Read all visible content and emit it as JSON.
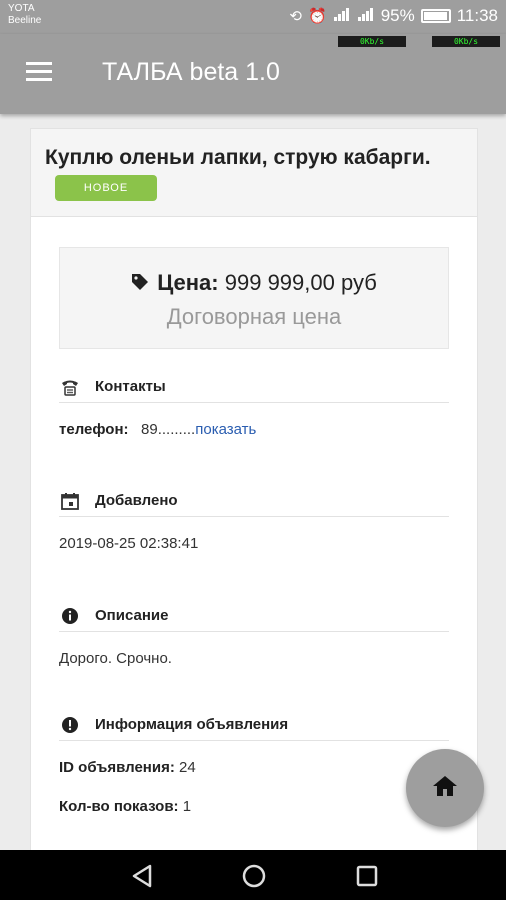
{
  "status_bar": {
    "carrier_line1": "YOTA",
    "carrier_line2": "Beeline",
    "battery": "95%",
    "time": "11:38",
    "net_speed_1": "0Kb/s",
    "net_speed_2": "0Kb/s"
  },
  "app_bar": {
    "title": "ТАЛБА beta 1.0"
  },
  "ad": {
    "title": "Куплю оленьи лапки, струю кабарги.",
    "badge": "НОВОЕ",
    "price_label": "Цена:",
    "price_value": "999 999,00 руб",
    "price_note": "Договорная цена"
  },
  "contacts": {
    "heading": "Контакты",
    "phone_label": "телефон:",
    "phone_value": "89.........",
    "show_link": "показать"
  },
  "added": {
    "heading": "Добавлено",
    "value": "2019-08-25 02:38:41"
  },
  "description": {
    "heading": "Описание",
    "text": "Дорого. Срочно."
  },
  "info": {
    "heading": "Информация объявления",
    "id_label": "ID объявления:",
    "id_value": "24",
    "views_label": "Кол-во показов:",
    "views_value": "1"
  },
  "colors": {
    "app_bar": "#9e9e9e",
    "badge": "#8bc34a",
    "link": "#2a5db0"
  },
  "icons": [
    "menu-icon",
    "tag-icon",
    "phone-icon",
    "calendar-icon",
    "info-icon",
    "alert-icon",
    "home-icon",
    "back-icon",
    "home-nav-icon",
    "recents-icon"
  ]
}
